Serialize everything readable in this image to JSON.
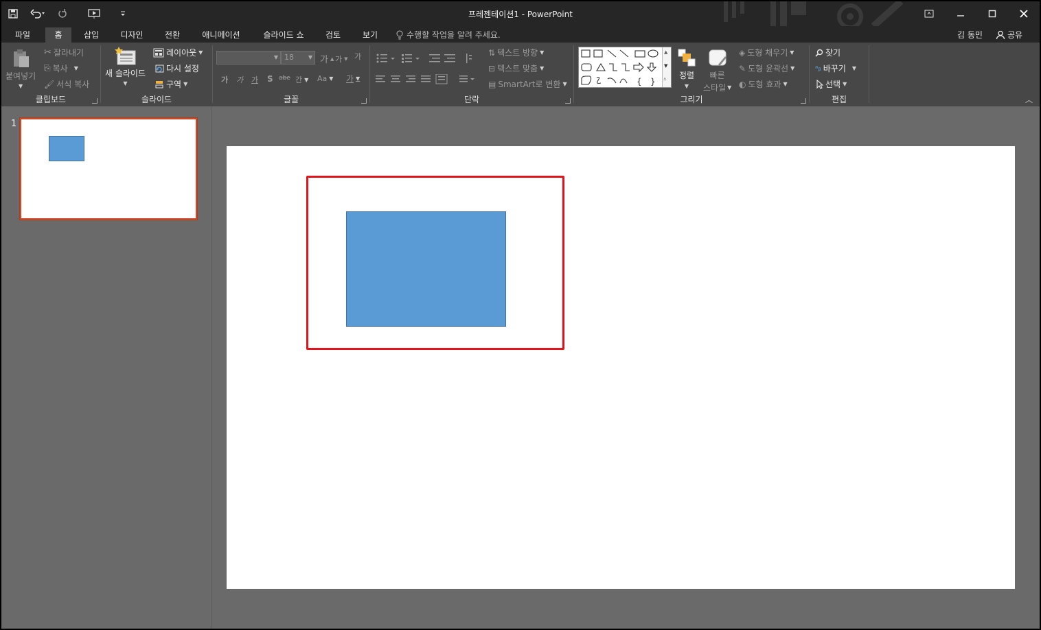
{
  "window": {
    "title": "프레젠테이션1 - PowerPoint",
    "qat_icons": [
      "save-icon",
      "undo-icon",
      "redo-icon",
      "slideshow-from-start-icon",
      "customize-qat-icon"
    ],
    "controls": [
      "ribbon-display-options-icon",
      "minimize-icon",
      "maximize-icon",
      "close-icon"
    ]
  },
  "tabs": [
    {
      "label": "파일",
      "active": false
    },
    {
      "label": "홈",
      "active": true
    },
    {
      "label": "삽입",
      "active": false
    },
    {
      "label": "디자인",
      "active": false
    },
    {
      "label": "전환",
      "active": false
    },
    {
      "label": "애니메이션",
      "active": false
    },
    {
      "label": "슬라이드 쇼",
      "active": false
    },
    {
      "label": "검토",
      "active": false
    },
    {
      "label": "보기",
      "active": false
    }
  ],
  "tell_me": "수행할 작업을 알려 주세요.",
  "user_name": "김 동민",
  "share_label": "공유",
  "ribbon": {
    "clipboard": {
      "label": "클립보드",
      "paste": "붙여넣기",
      "cut": "잘라내기",
      "copy": "복사",
      "format_painter": "서식 복사"
    },
    "slides": {
      "label": "슬라이드",
      "new_slide": "새 슬라이드",
      "layout": "레이아웃",
      "reset": "다시 설정",
      "section": "구역"
    },
    "font": {
      "label": "글꼴",
      "font_name": "",
      "font_size": "18",
      "grow": "가",
      "shrink": "가",
      "clear": "가",
      "bold": "가",
      "italic": "가",
      "underline": "가",
      "shadow": "S",
      "strike": "abe",
      "spacing": "간",
      "case": "Aa",
      "color": "가"
    },
    "paragraph": {
      "label": "단락",
      "text_direction": "텍스트 방향",
      "align_text": "텍스트 맞춤",
      "smartart": "SmartArt로 변환"
    },
    "drawing": {
      "label": "그리기",
      "arrange": "정렬",
      "quick_styles_1": "빠른",
      "quick_styles_2": "스타일",
      "shape_fill": "도형 채우기",
      "shape_outline": "도형 윤곽선",
      "shape_effects": "도형 효과"
    },
    "editing": {
      "label": "편집",
      "find": "찾기",
      "replace": "바꾸기",
      "select": "선택"
    }
  },
  "slides": [
    {
      "number": "1",
      "selected": true,
      "shapes": [
        {
          "type": "rectangle",
          "fill": "#5b9bd5",
          "outline": "#41719c"
        }
      ]
    }
  ],
  "colors": {
    "titlebar": "#262626",
    "ribbon": "#474747",
    "workspace": "#6a6a6a",
    "selected_thumb_border": "#d24726",
    "shape_fill": "#5b9bd5",
    "annotation_red": "#e0141a"
  }
}
